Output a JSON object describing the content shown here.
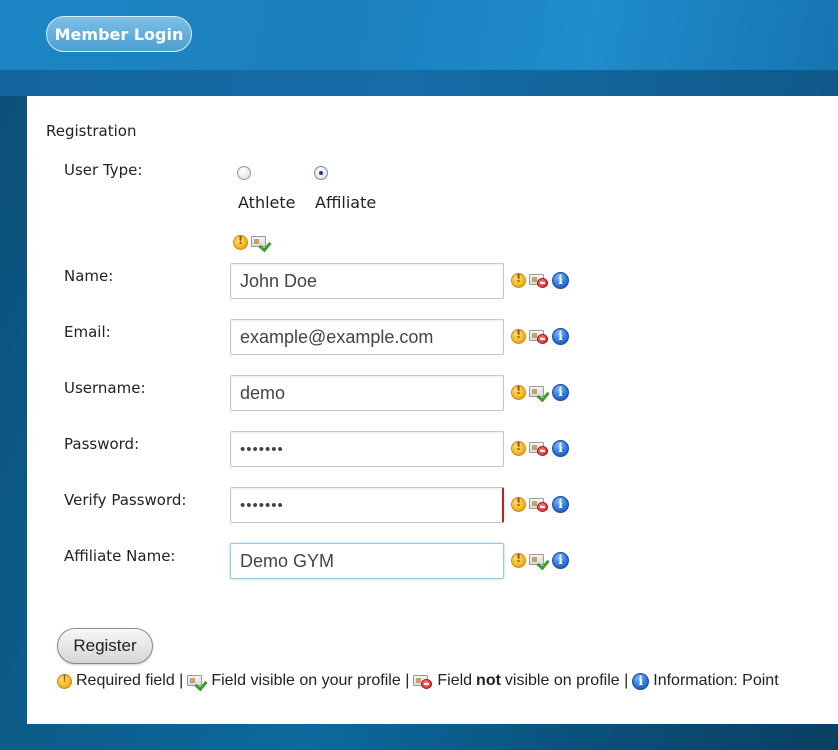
{
  "header": {
    "member_login_label": "Member Login"
  },
  "form": {
    "title": "Registration",
    "user_type": {
      "label": "User Type:",
      "options": [
        {
          "label": "Athlete",
          "checked": false
        },
        {
          "label": "Affiliate",
          "checked": true
        }
      ]
    },
    "fields": [
      {
        "label": "Name:",
        "value": "John Doe",
        "type": "text",
        "visible_on_profile": false
      },
      {
        "label": "Email:",
        "value": "example@example.com",
        "type": "text",
        "visible_on_profile": false
      },
      {
        "label": "Username:",
        "value": "demo",
        "type": "text",
        "visible_on_profile": true
      },
      {
        "label": "Password:",
        "value": "1234567",
        "type": "password",
        "visible_on_profile": false
      },
      {
        "label": "Verify Password:",
        "value": "1234567",
        "type": "password",
        "visible_on_profile": false
      },
      {
        "label": "Affiliate Name:",
        "value": "Demo GYM",
        "type": "text",
        "visible_on_profile": true
      }
    ],
    "register_label": "Register"
  },
  "legend": {
    "required": "Required field |",
    "visible": "Field visible on your profile |",
    "not_visible_pre": "Field",
    "not_visible_bold": "not",
    "not_visible_post": "visible on profile |",
    "information": "Information: Point"
  },
  "icons": {
    "required": "required-icon",
    "visible": "profile-visible-icon",
    "not_visible": "profile-hidden-icon",
    "info": "info-icon"
  },
  "colors": {
    "header_blue": "#1c86c4",
    "background_dark": "#0b4f78",
    "error_border": "#c61e1e"
  }
}
